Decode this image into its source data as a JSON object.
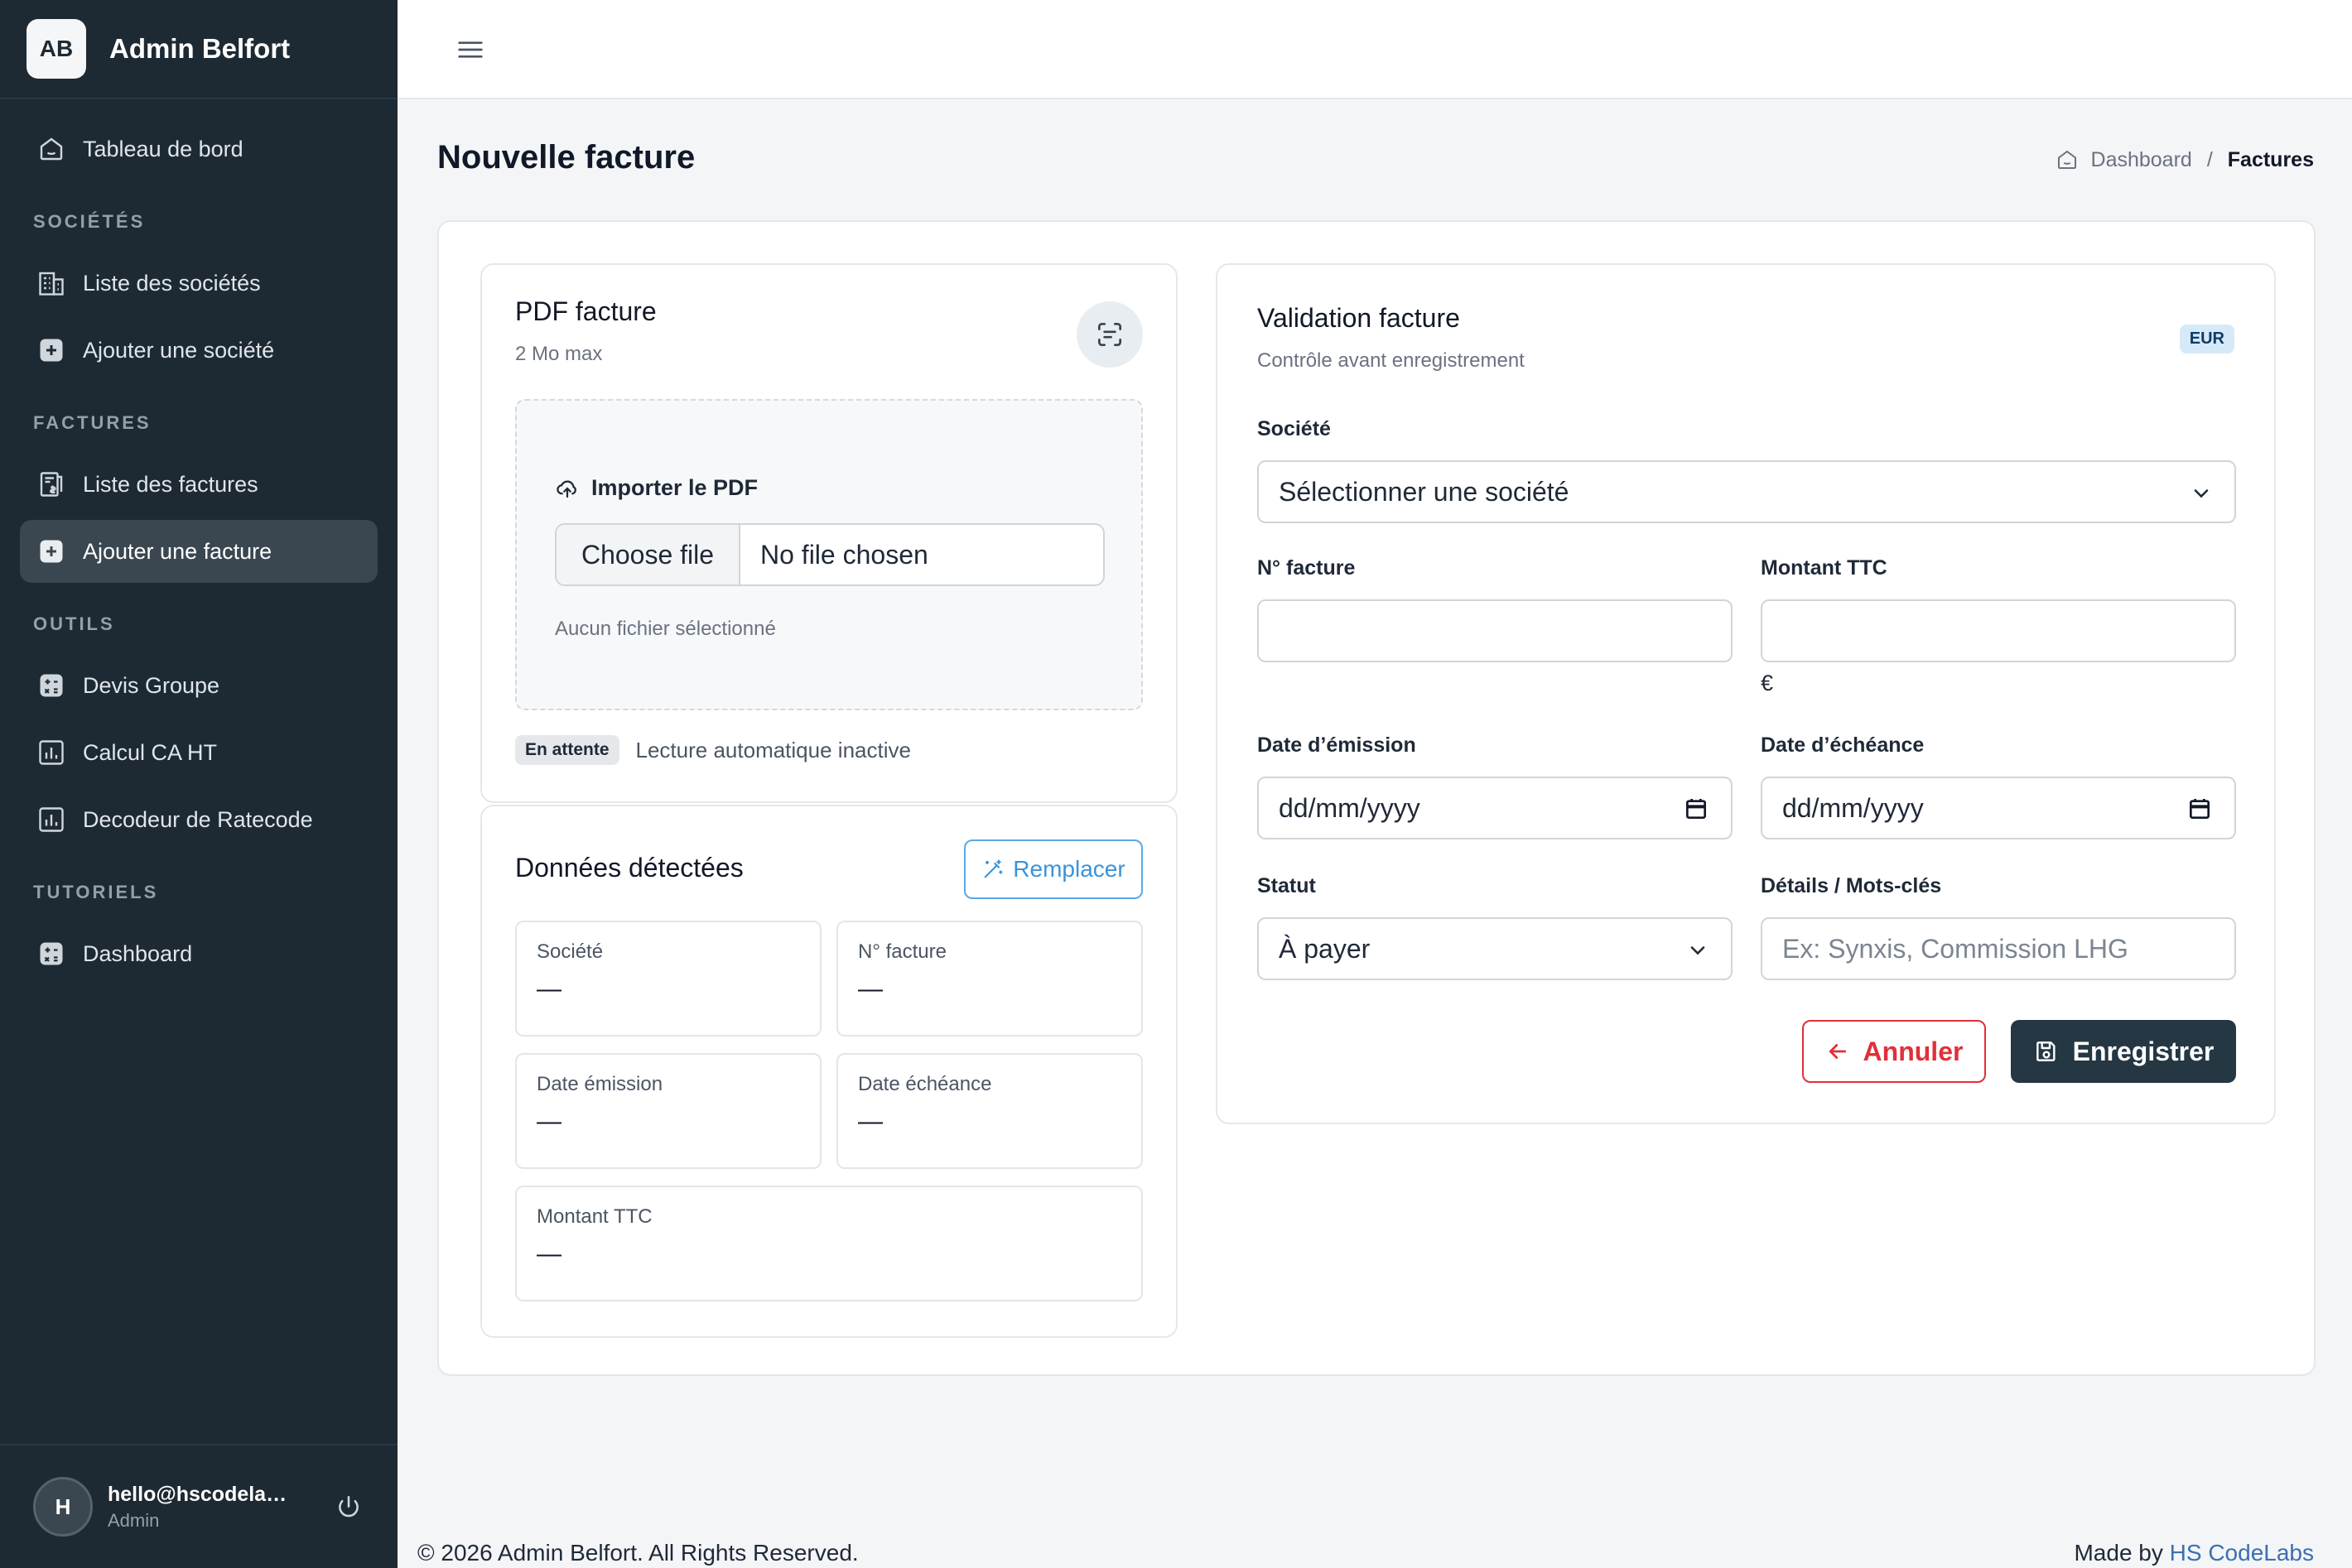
{
  "brand": {
    "initials": "AB",
    "name": "Admin Belfort"
  },
  "sidebar": {
    "dashboard": "Tableau de bord",
    "sections": [
      {
        "title": "SOCIÉTÉS",
        "items": [
          "Liste des sociétés",
          "Ajouter une société"
        ]
      },
      {
        "title": "FACTURES",
        "items": [
          "Liste des factures",
          "Ajouter une facture"
        ]
      },
      {
        "title": "OUTILS",
        "items": [
          "Devis Groupe",
          "Calcul CA HT",
          "Decodeur de Ratecode"
        ]
      },
      {
        "title": "TUTORIELS",
        "items": [
          "Dashboard"
        ]
      }
    ],
    "active_item": "Ajouter une facture"
  },
  "user": {
    "initial": "H",
    "email": "hello@hscodelabs.com",
    "role": "Admin"
  },
  "page": {
    "title": "Nouvelle facture"
  },
  "breadcrumb": {
    "home": "Dashboard",
    "separator": "/",
    "current": "Factures"
  },
  "pdf_panel": {
    "title": "PDF facture",
    "subtitle": "2 Mo max",
    "import_label": "Importer le PDF",
    "file_button": "Choose file",
    "file_status": "No file chosen",
    "no_file_text": "Aucun fichier sélectionné",
    "badge": "En attente",
    "status_text": "Lecture automatique inactive"
  },
  "detected_panel": {
    "title": "Données détectées",
    "replace_button": "Remplacer",
    "fields": [
      {
        "label": "Société",
        "value": "—"
      },
      {
        "label": "N° facture",
        "value": "—"
      },
      {
        "label": "Date émission",
        "value": "—"
      },
      {
        "label": "Date échéance",
        "value": "—"
      },
      {
        "label": "Montant TTC",
        "value": "—"
      }
    ]
  },
  "validation_panel": {
    "title": "Validation facture",
    "subtitle": "Contrôle avant enregistrement",
    "currency_badge": "EUR",
    "company_label": "Société",
    "company_value": "Sélectionner une société",
    "invoice_no_label": "N° facture",
    "invoice_no_value": "",
    "amount_label": "Montant TTC",
    "amount_value": "",
    "amount_suffix": "€",
    "issue_date_label": "Date d’émission",
    "issue_date_value": "dd/mm/yyyy",
    "due_date_label": "Date d’échéance",
    "due_date_value": "dd/mm/yyyy",
    "status_label": "Statut",
    "status_value": "À payer",
    "details_label": "Détails / Mots-clés",
    "details_placeholder": "Ex: Synxis, Commission LHG",
    "cancel_button": "Annuler",
    "save_button": "Enregistrer"
  },
  "footer": {
    "copyright": "© 2026 Admin Belfort. All Rights Reserved.",
    "made_by": "Made by",
    "made_by_brand": "HS CodeLabs"
  },
  "colors": {
    "sidebar_bg": "#1e2a33",
    "accent_blue": "#3b93d9",
    "danger": "#e0303a",
    "primary_dark": "#243743"
  }
}
